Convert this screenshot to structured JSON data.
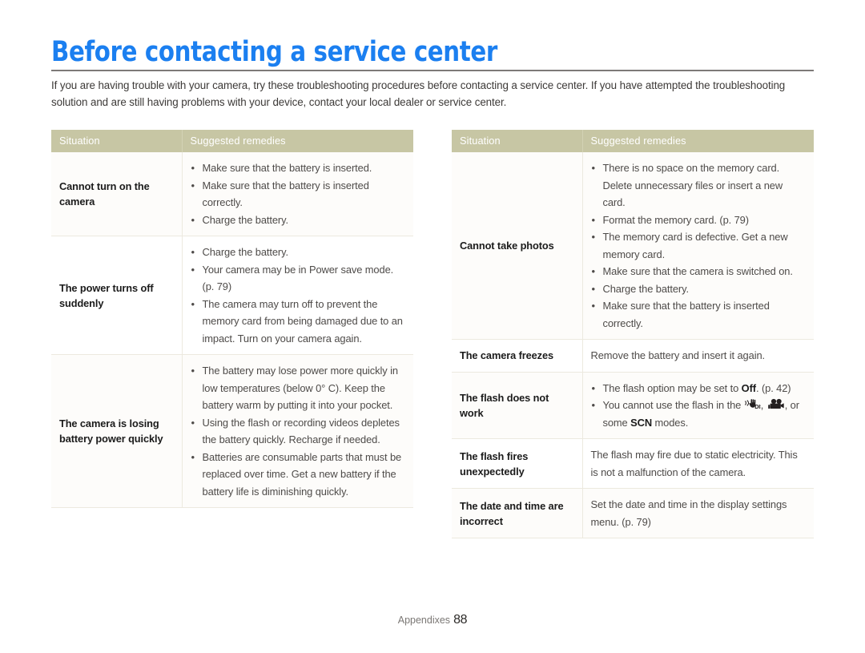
{
  "document": {
    "title": "Before contacting a service center",
    "title_color": "#1b7ff0",
    "intro": "If you are having trouble with your camera, try these troubleshooting procedures before contacting a service center. If you have attempted the troubleshooting solution and are still having problems with your device, contact your local dealer or service center.",
    "header_bg": "#c7c6a4"
  },
  "footer": {
    "section_label": "Appendixes",
    "page_number": "88"
  },
  "tables": {
    "left": {
      "headers": {
        "situation": "Situation",
        "remedies": "Suggested remedies"
      },
      "rows": [
        {
          "situation": "Cannot turn on the camera",
          "remedies": [
            "Make sure that the battery is inserted.",
            "Make sure that the battery is inserted correctly.",
            "Charge the battery."
          ]
        },
        {
          "situation": "The power turns off suddenly",
          "remedies": [
            "Charge the battery.",
            "Your camera may be in Power save mode. (p. 79)",
            "The camera may turn off to prevent the memory card from being damaged due to an impact. Turn on your camera again."
          ]
        },
        {
          "situation": "The camera is losing battery power quickly",
          "remedies": [
            "The battery may lose power more quickly in low temperatures (below 0° C). Keep the battery warm by putting it into your pocket.",
            "Using the flash or recording videos depletes the battery quickly. Recharge if needed.",
            "Batteries are consumable parts that must be replaced over time. Get a new battery if the battery life is diminishing quickly."
          ]
        }
      ]
    },
    "right": {
      "headers": {
        "situation": "Situation",
        "remedies": "Suggested remedies"
      },
      "rows": [
        {
          "situation": "Cannot take photos",
          "remedies": [
            "There is no space on the memory card. Delete unnecessary files or insert a new card.",
            "Format the memory card. (p. 79)",
            "The memory card is defective. Get a new memory card.",
            "Make sure that the camera is switched on.",
            "Charge the battery.",
            "Make sure that the battery is inserted correctly."
          ]
        },
        {
          "situation": "The camera freezes",
          "plain_remedy": "Remove the battery and insert it again."
        },
        {
          "situation": "The flash does not work",
          "remedy_flash_1_pre": "The flash option may be set to ",
          "remedy_flash_1_bold": "Off",
          "remedy_flash_1_post": ". (p. 42)",
          "remedy_flash_2_pre": "You cannot use the flash in the ",
          "remedy_flash_2_icon1": "dis-mode-icon",
          "remedy_flash_2_mid": ", ",
          "remedy_flash_2_icon2": "movie-camera-icon",
          "remedy_flash_2_mid2": ", or some ",
          "remedy_flash_2_bold": "SCN",
          "remedy_flash_2_post": " modes."
        },
        {
          "situation": "The flash fires unexpectedly",
          "plain_remedy": "The flash may fire due to static electricity. This is not a malfunction of the camera."
        },
        {
          "situation": "The date and time are incorrect",
          "plain_remedy": "Set the date and time in the display settings menu. (p. 79)"
        }
      ]
    }
  }
}
